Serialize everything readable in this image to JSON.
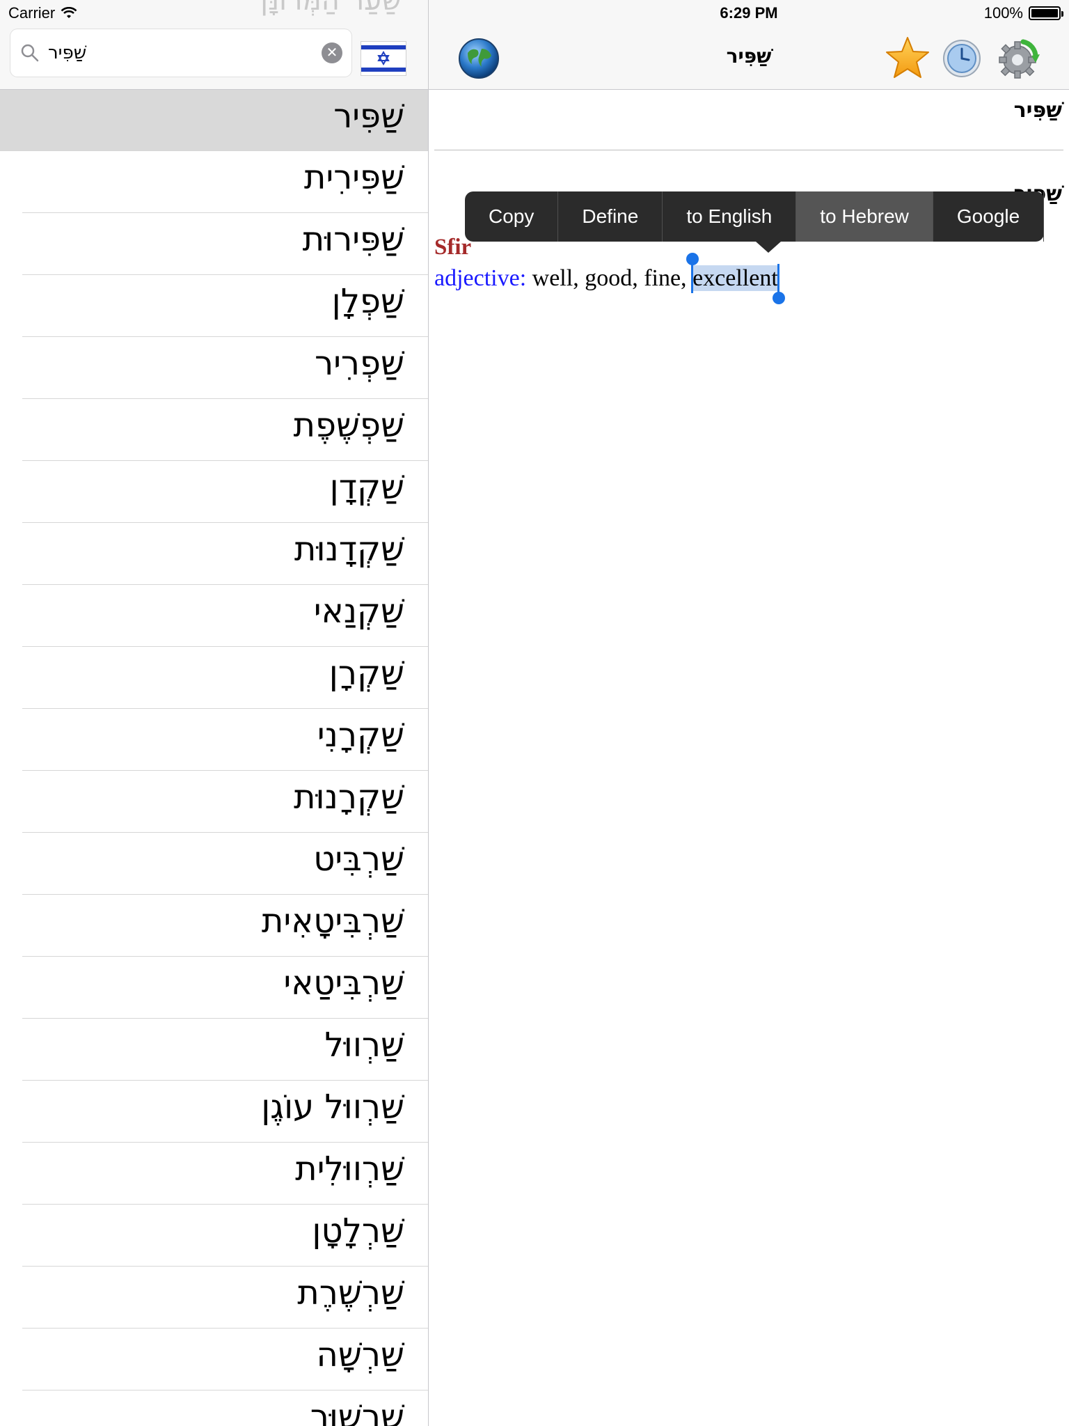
{
  "status_bar": {
    "carrier": "Carrier",
    "time": "6:29 PM",
    "battery": "100%"
  },
  "left_pane": {
    "ghost_title": "שַׁעַר הַמְּרוּנָּן",
    "search": {
      "value": "שַׁפִּיר",
      "placeholder": ""
    },
    "flag_icon": "israel-flag-icon",
    "words": [
      "שַׁפִּיר",
      "שַׁפִּירִית",
      "שַׁפִּירוּת",
      "שַׁפְלָן",
      "שַׁפְרִיר",
      "שַׁפְשֶׁפֶת",
      "שַׁקְדָן",
      "שַׁקְדָנוּת",
      "שַׁקְנַאי",
      "שַׁקְרָן",
      "שַׁקְרָנִי",
      "שַׁקְרָנוּת",
      "שַׁרְבִּיט",
      "שַׁרְבִּיטָאִית",
      "שַׁרְבִּיטַאי",
      "שַׁרְווּל",
      "שַׁרְווּל עוֹגֶן",
      "שַׁרְווּלִית",
      "שַׁרְלָטָן",
      "שַׁרְשֶׁרֶת",
      "שַׁרְשָׁה",
      "שַׁרְשׁוּר"
    ],
    "selected_index": 0
  },
  "right_pane": {
    "title": "שַׁפִּיר",
    "entry_word": "שַׁפִּיר",
    "transliteration": "Sfir",
    "pos": "adjective:",
    "definition_prefix": "well, good, fine,",
    "selected_word": "excellent",
    "edit_menu": [
      "Copy",
      "Define",
      "to English",
      "to Hebrew",
      "Google"
    ],
    "edit_menu_active": "to Hebrew"
  },
  "colors": {
    "selection": "#c6d8f1",
    "handle": "#1a73e8",
    "transliteration": "#a52a2a",
    "pos": "#1a1aff"
  }
}
